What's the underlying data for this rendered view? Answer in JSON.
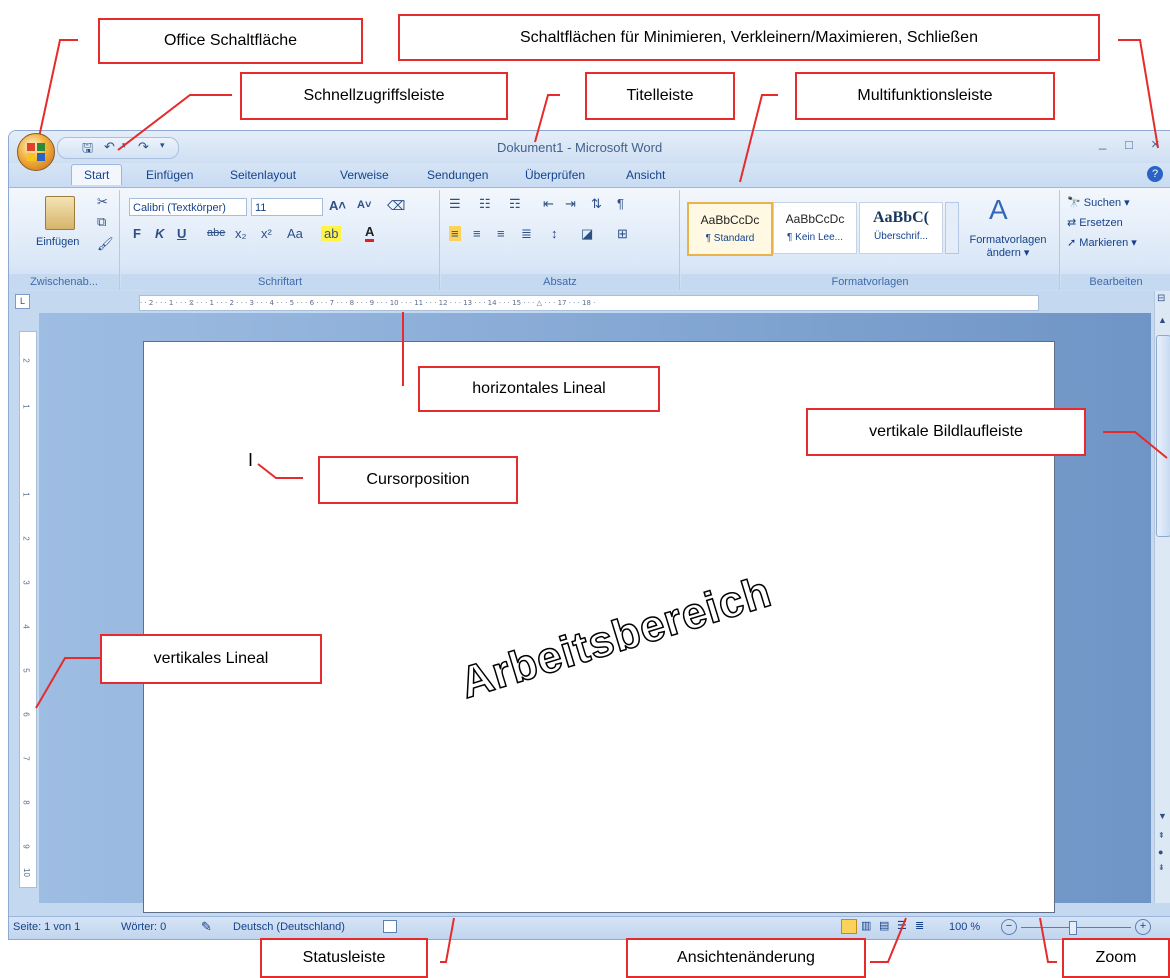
{
  "window": {
    "title": "Dokument1 - Microsoft Word",
    "controls": [
      "_",
      "□",
      "×"
    ]
  },
  "tabs": [
    "Start",
    "Einfügen",
    "Seitenlayout",
    "Verweise",
    "Sendungen",
    "Überprüfen",
    "Ansicht"
  ],
  "ribbon": {
    "clipboard": {
      "paste_label": "Einfügen",
      "group_label": "Zwischenab..."
    },
    "font": {
      "font_name": "Calibri (Textkörper)",
      "font_size": "11",
      "group_label": "Schriftart",
      "bold": "F",
      "italic": "K",
      "underline": "U",
      "strike": "abe",
      "sub": "x₂",
      "sup": "x²",
      "case": "Aa"
    },
    "paragraph": {
      "group_label": "Absatz"
    },
    "styles": {
      "group_label": "Formatvorlagen",
      "tiles": [
        {
          "sample": "AaBbCcDc",
          "name": "¶ Standard"
        },
        {
          "sample": "AaBbCcDc",
          "name": "¶ Kein Lee..."
        },
        {
          "sample": "AaBbC(",
          "name": "Überschrif..."
        }
      ],
      "change_label_1": "Formatvorlagen",
      "change_label_2": "ändern ▾"
    },
    "editing": {
      "group_label": "Bearbeiten",
      "find": "Suchen ▾",
      "replace": "Ersetzen",
      "select": "Markieren ▾"
    }
  },
  "ruler": {
    "horizontal_marks": "· · 2 · · · 1 · · · ⧖ · · · 1 · · · 2 · · · 3 · · · 4 · · · 5 · · · 6 · · · 7 · · · 8 · · · 9 · · · 10 · · · 11 · · · 12 · · · 13 · · · 14 · · · 15 · · · △ · · · 17 · · · 18 ·",
    "vertical_marks": [
      "2",
      "1",
      "1",
      "2",
      "3",
      "4",
      "5",
      "6",
      "7",
      "8",
      "9",
      "10"
    ]
  },
  "document": {
    "cursor": "I",
    "workspace_text": "Arbeitsbereich"
  },
  "statusbar": {
    "page": "Seite: 1 von 1",
    "words": "Wörter: 0",
    "language": "Deutsch (Deutschland)",
    "zoom": "100 %",
    "zoom_minus": "−",
    "zoom_plus": "+"
  },
  "callouts": {
    "office_button": "Office Schaltfläche",
    "window_buttons": "Schaltflächen für Minimieren, Verkleinern/Maximieren, Schließen",
    "quick_access": "Schnellzugriffsleiste",
    "title_bar": "Titelleiste",
    "ribbon": "Multifunktionsleiste",
    "h_ruler": "horizontales Lineal",
    "v_scrollbar": "vertikale Bildlaufleiste",
    "cursor": "Cursorposition",
    "v_ruler": "vertikales Lineal",
    "status_bar": "Statusleiste",
    "view_change": "Ansichtenänderung",
    "zoom": "Zoom"
  },
  "colors": {
    "callout_border": "#e52b2b",
    "ribbon_text": "#15428b",
    "doc_background": "#6f95c6"
  }
}
